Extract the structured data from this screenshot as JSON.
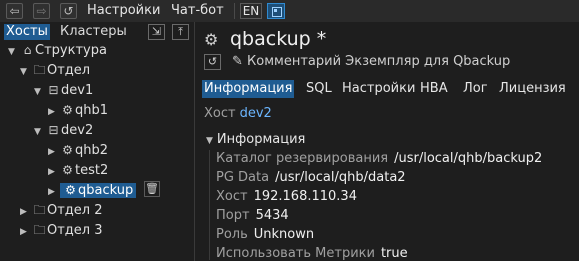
{
  "menu": {
    "settings": "Настройки",
    "chatbot": "Чат-бот",
    "lang": "EN"
  },
  "left": {
    "tabs": [
      "Хосты",
      "Кластеры"
    ],
    "tree": [
      {
        "label": "Структура",
        "icon": "home-icon"
      },
      {
        "label": "Отдел",
        "icon": "folder-icon"
      },
      {
        "label": "dev1",
        "icon": "server-icon"
      },
      {
        "label": "qhb1",
        "icon": "db-icon"
      },
      {
        "label": "dev2",
        "icon": "server-icon"
      },
      {
        "label": "qhb2",
        "icon": "db-icon"
      },
      {
        "label": "test2",
        "icon": "db-icon"
      },
      {
        "label": "qbackup",
        "icon": "db-icon"
      },
      {
        "label": "Отдел 2",
        "icon": "folder-icon"
      },
      {
        "label": "Отдел 3",
        "icon": "folder-icon"
      }
    ]
  },
  "right": {
    "title": "qbackup *",
    "comment": "Комментарий Экземпляр для Qbackup",
    "tabs": [
      "Информация",
      "SQL",
      "Настройки",
      "HBA",
      "Лог",
      "Лицензия"
    ],
    "host_key": "Хост",
    "host_value": "dev2",
    "section": "Информация",
    "props": [
      {
        "k": "Каталог резервирования",
        "v": "/usr/local/qhb/backup2"
      },
      {
        "k": "PG Data",
        "v": "/usr/local/qhb/data2"
      },
      {
        "k": "Хост",
        "v": "192.168.110.34"
      },
      {
        "k": "Порт",
        "v": "5434"
      },
      {
        "k": "Роль",
        "v": "Unknown"
      },
      {
        "k": "Использовать Метрики",
        "v": "true"
      }
    ]
  }
}
